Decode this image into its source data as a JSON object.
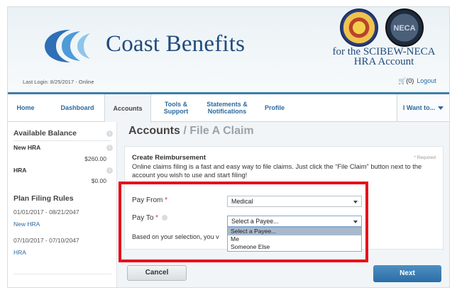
{
  "header": {
    "brand": "Coast Benefits",
    "subbrand_line1": "for the SCIBEW-NECA",
    "subbrand_line2": "HRA Account",
    "seal2_text": "NECA",
    "last_login": "Last Login: 8/25/2017 - Online",
    "cart": "(0)",
    "logout": "Logout"
  },
  "nav": {
    "items": [
      {
        "label": "Home"
      },
      {
        "label": "Dashboard"
      },
      {
        "label": "Accounts"
      },
      {
        "label": "Tools &\nSupport"
      },
      {
        "label": "Statements &\nNotifications"
      },
      {
        "label": "Profile"
      }
    ],
    "i_want": "I Want to..."
  },
  "sidebar": {
    "balance_title": "Available Balance",
    "accounts": [
      {
        "name": "New HRA",
        "amount": "$260.00"
      },
      {
        "name": "HRA",
        "amount": "$0.00"
      }
    ],
    "rules_title": "Plan Filing Rules",
    "rules": [
      {
        "dates": "01/01/2017 - 08/21/2047",
        "link": "New HRA"
      },
      {
        "dates": "07/10/2017 - 07/10/2047",
        "link": "HRA"
      }
    ]
  },
  "main": {
    "title": "Accounts",
    "title_sub": "/ File A Claim",
    "card_title": "Create Reimbursement",
    "required": "* Required",
    "description": "Online claims filing is a fast and easy way to file claims. Just click the “File Claim” button next to the account you wish to use and start filing!",
    "pay_from_label": "Pay From",
    "pay_from_value": "Medical",
    "pay_to_label": "Pay To",
    "pay_to_value": "Select a Payee...",
    "payee_options": [
      "Select a Payee...",
      "Me",
      "Someone Else"
    ],
    "based_text": "Based on your selection, you v",
    "cancel": "Cancel",
    "next": "Next"
  },
  "colors": {
    "accent": "#2d6aa0",
    "highlight": "#e8101c",
    "next_button": "#3b7fb6"
  }
}
